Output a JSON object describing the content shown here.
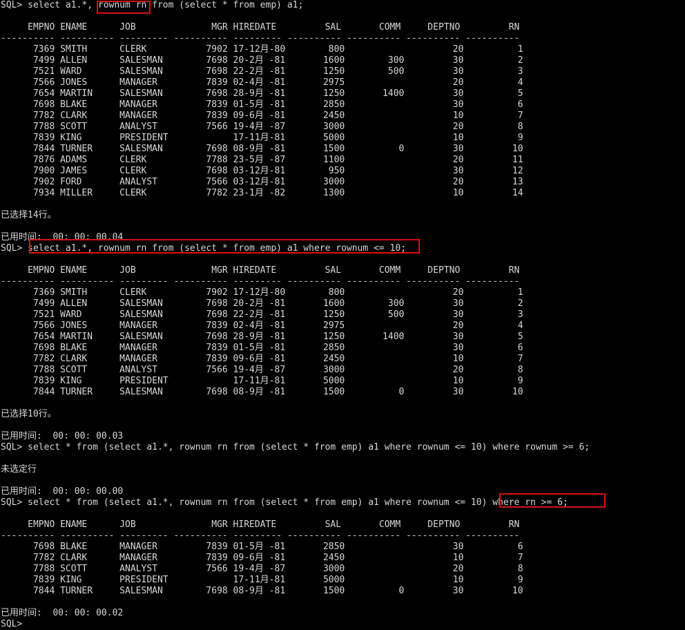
{
  "terminal": {
    "app": "SQL*Plus",
    "prompt": "SQL>",
    "background_color": "#000000",
    "text_color": "#d8d8d8",
    "highlight_color": "#d81010"
  },
  "columns": {
    "headers": [
      "EMPNO",
      "ENAME",
      "JOB",
      "MGR",
      "HIREDATE",
      "SAL",
      "COMM",
      "DEPTNO",
      "RN"
    ],
    "separator": "---------- ---------- --------- ---------- --------- ---------- ---------- ---------- ----------"
  },
  "blocks": {
    "b1": {
      "command": "SQL> select a1.*, rownum rn from (select * from emp) a1;",
      "header": "     EMPNO ENAME      JOB              MGR HIREDATE         SAL       COMM     DEPTNO         RN",
      "separator": "---------- ---------- --------- ---------- --------- ---------- ---------- ---------- ----------",
      "rows": [
        "      7369 SMITH      CLERK           7902 17-12月-80        800                    20          1",
        "      7499 ALLEN      SALESMAN        7698 20-2月 -81       1600        300         30          2",
        "      7521 WARD       SALESMAN        7698 22-2月 -81       1250        500         30          3",
        "      7566 JONES      MANAGER         7839 02-4月 -81       2975                    20          4",
        "      7654 MARTIN     SALESMAN        7698 28-9月 -81       1250       1400         30          5",
        "      7698 BLAKE      MANAGER         7839 01-5月 -81       2850                    30          6",
        "      7782 CLARK      MANAGER         7839 09-6月 -81       2450                    10          7",
        "      7788 SCOTT      ANALYST         7566 19-4月 -87       3000                    20          8",
        "      7839 KING       PRESIDENT            17-11月-81       5000                    10          9",
        "      7844 TURNER     SALESMAN        7698 08-9月 -81       1500          0         30         10",
        "      7876 ADAMS      CLERK           7788 23-5月 -87       1100                    20         11",
        "      7900 JAMES      CLERK           7698 03-12月-81        950                    30         12",
        "      7902 FORD       ANALYST         7566 03-12月-81       3000                    20         13",
        "      7934 MILLER     CLERK           7782 23-1月 -82       1300                    10         14"
      ],
      "row_count_message": "已选择14行。",
      "elapsed_message": "已用时间:  00: 00: 00.04"
    },
    "b2": {
      "command": "SQL> select a1.*, rownum rn from (select * from emp) a1 where rownum <= 10;",
      "header": "     EMPNO ENAME      JOB              MGR HIREDATE         SAL       COMM     DEPTNO         RN",
      "separator": "---------- ---------- --------- ---------- --------- ---------- ---------- ---------- ----------",
      "rows": [
        "      7369 SMITH      CLERK           7902 17-12月-80        800                    20          1",
        "      7499 ALLEN      SALESMAN        7698 20-2月 -81       1600        300         30          2",
        "      7521 WARD       SALESMAN        7698 22-2月 -81       1250        500         30          3",
        "      7566 JONES      MANAGER         7839 02-4月 -81       2975                    20          4",
        "      7654 MARTIN     SALESMAN        7698 28-9月 -81       1250       1400         30          5",
        "      7698 BLAKE      MANAGER         7839 01-5月 -81       2850                    30          6",
        "      7782 CLARK      MANAGER         7839 09-6月 -81       2450                    10          7",
        "      7788 SCOTT      ANALYST         7566 19-4月 -87       3000                    20          8",
        "      7839 KING       PRESIDENT            17-11月-81       5000                    10          9",
        "      7844 TURNER     SALESMAN        7698 08-9月 -81       1500          0         30         10"
      ],
      "row_count_message": "已选择10行。",
      "elapsed_message": "已用时间:  00: 00: 00.03"
    },
    "b3": {
      "command": "SQL> select * from (select a1.*, rownum rn from (select * from emp) a1 where rownum <= 10) where rownum >= 6;",
      "row_count_message": "未选定行",
      "elapsed_message": "已用时间:  00: 00: 00.00"
    },
    "b4": {
      "command": "SQL> select * from (select a1.*, rownum rn from (select * from emp) a1 where rownum <= 10) where rn >= 6;",
      "header": "     EMPNO ENAME      JOB              MGR HIREDATE         SAL       COMM     DEPTNO         RN",
      "separator": "---------- ---------- --------- ---------- --------- ---------- ---------- ---------- ----------",
      "rows": [
        "      7698 BLAKE      MANAGER         7839 01-5月 -81       2850                    30          6",
        "      7782 CLARK      MANAGER         7839 09-6月 -81       2450                    10          7",
        "      7788 SCOTT      ANALYST         7566 19-4月 -87       3000                    20          8",
        "      7839 KING       PRESIDENT            17-11月-81       5000                    10          9",
        "      7844 TURNER     SALESMAN        7698 08-9月 -81       1500          0         30         10"
      ],
      "elapsed_message": "已用时间:  00: 00: 00.02",
      "final_prompt": "SQL>"
    }
  },
  "highlights": [
    {
      "name": "rownum-rn-highlight",
      "text": "rownum rn"
    },
    {
      "name": "full-query-highlight",
      "text": "select a1.*, rownum rn from (select * from emp) a1 where rownum <= 10;"
    },
    {
      "name": "where-rn-highlight",
      "text": "where rn >= 6;"
    }
  ],
  "table_data": {
    "type": "table",
    "columns": [
      "EMPNO",
      "ENAME",
      "JOB",
      "MGR",
      "HIREDATE",
      "SAL",
      "COMM",
      "DEPTNO",
      "RN"
    ],
    "emp_rows": [
      {
        "EMPNO": 7369,
        "ENAME": "SMITH",
        "JOB": "CLERK",
        "MGR": 7902,
        "HIREDATE": "17-12月-80",
        "SAL": 800,
        "COMM": null,
        "DEPTNO": 20,
        "RN": 1
      },
      {
        "EMPNO": 7499,
        "ENAME": "ALLEN",
        "JOB": "SALESMAN",
        "MGR": 7698,
        "HIREDATE": "20-2月 -81",
        "SAL": 1600,
        "COMM": 300,
        "DEPTNO": 30,
        "RN": 2
      },
      {
        "EMPNO": 7521,
        "ENAME": "WARD",
        "JOB": "SALESMAN",
        "MGR": 7698,
        "HIREDATE": "22-2月 -81",
        "SAL": 1250,
        "COMM": 500,
        "DEPTNO": 30,
        "RN": 3
      },
      {
        "EMPNO": 7566,
        "ENAME": "JONES",
        "JOB": "MANAGER",
        "MGR": 7839,
        "HIREDATE": "02-4月 -81",
        "SAL": 2975,
        "COMM": null,
        "DEPTNO": 20,
        "RN": 4
      },
      {
        "EMPNO": 7654,
        "ENAME": "MARTIN",
        "JOB": "SALESMAN",
        "MGR": 7698,
        "HIREDATE": "28-9月 -81",
        "SAL": 1250,
        "COMM": 1400,
        "DEPTNO": 30,
        "RN": 5
      },
      {
        "EMPNO": 7698,
        "ENAME": "BLAKE",
        "JOB": "MANAGER",
        "MGR": 7839,
        "HIREDATE": "01-5月 -81",
        "SAL": 2850,
        "COMM": null,
        "DEPTNO": 30,
        "RN": 6
      },
      {
        "EMPNO": 7782,
        "ENAME": "CLARK",
        "JOB": "MANAGER",
        "MGR": 7839,
        "HIREDATE": "09-6月 -81",
        "SAL": 2450,
        "COMM": null,
        "DEPTNO": 10,
        "RN": 7
      },
      {
        "EMPNO": 7788,
        "ENAME": "SCOTT",
        "JOB": "ANALYST",
        "MGR": 7566,
        "HIREDATE": "19-4月 -87",
        "SAL": 3000,
        "COMM": null,
        "DEPTNO": 20,
        "RN": 8
      },
      {
        "EMPNO": 7839,
        "ENAME": "KING",
        "JOB": "PRESIDENT",
        "MGR": null,
        "HIREDATE": "17-11月-81",
        "SAL": 5000,
        "COMM": null,
        "DEPTNO": 10,
        "RN": 9
      },
      {
        "EMPNO": 7844,
        "ENAME": "TURNER",
        "JOB": "SALESMAN",
        "MGR": 7698,
        "HIREDATE": "08-9月 -81",
        "SAL": 1500,
        "COMM": 0,
        "DEPTNO": 30,
        "RN": 10
      },
      {
        "EMPNO": 7876,
        "ENAME": "ADAMS",
        "JOB": "CLERK",
        "MGR": 7788,
        "HIREDATE": "23-5月 -87",
        "SAL": 1100,
        "COMM": null,
        "DEPTNO": 20,
        "RN": 11
      },
      {
        "EMPNO": 7900,
        "ENAME": "JAMES",
        "JOB": "CLERK",
        "MGR": 7698,
        "HIREDATE": "03-12月-81",
        "SAL": 950,
        "COMM": null,
        "DEPTNO": 30,
        "RN": 12
      },
      {
        "EMPNO": 7902,
        "ENAME": "FORD",
        "JOB": "ANALYST",
        "MGR": 7566,
        "HIREDATE": "03-12月-81",
        "SAL": 3000,
        "COMM": null,
        "DEPTNO": 20,
        "RN": 13
      },
      {
        "EMPNO": 7934,
        "ENAME": "MILLER",
        "JOB": "CLERK",
        "MGR": 7782,
        "HIREDATE": "23-1月 -82",
        "SAL": 1300,
        "COMM": null,
        "DEPTNO": 10,
        "RN": 14
      }
    ]
  }
}
